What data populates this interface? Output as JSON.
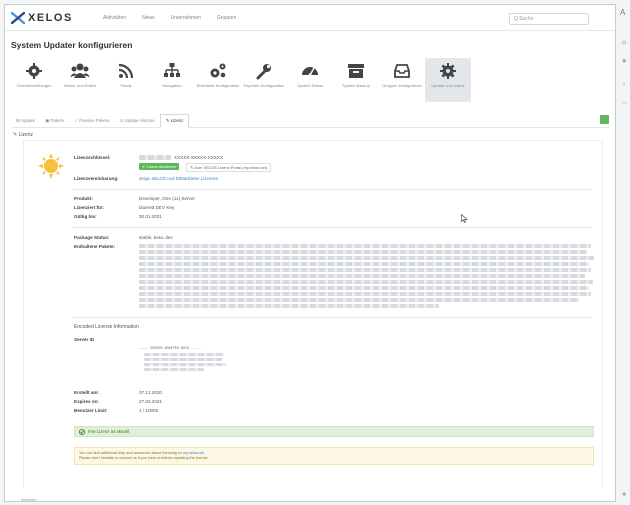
{
  "app": {
    "logo_text": "XELOS",
    "search_placeholder": "Q Suche"
  },
  "nav": [
    "Aktivitäten",
    "News",
    "Unternehmen",
    "Gruppen"
  ],
  "page_title": "System Updater konfigurieren",
  "iconbar": [
    {
      "label": "Grundeinstellungen",
      "icon": "gear-icon"
    },
    {
      "label": "Nutzer und Rollen",
      "icon": "users-icon"
    },
    {
      "label": "Feeds",
      "icon": "rss-icon"
    },
    {
      "label": "Navigation",
      "icon": "sitemap-icon"
    },
    {
      "label": "Erweiterte Konfiguration",
      "icon": "gears-icon"
    },
    {
      "label": "Experten Konfiguration",
      "icon": "wrench-icon"
    },
    {
      "label": "System Status",
      "icon": "dashboard-icon"
    },
    {
      "label": "System Backup",
      "icon": "archive-icon"
    },
    {
      "label": "Gruppen konfigurieren",
      "icon": "inbox-icon"
    },
    {
      "label": "Update und Lizenz",
      "icon": "cog-icon"
    }
  ],
  "tabs": [
    {
      "label": "⊞ Update",
      "active": false
    },
    {
      "label": "▣ Pakete",
      "active": false
    },
    {
      "label": "☆ Passive Pakete",
      "active": false
    },
    {
      "label": "⊙ Update Historie",
      "active": false
    },
    {
      "label": "✎ Lizenz",
      "active": true
    }
  ],
  "section_heading": "✎ Lizenz",
  "license": {
    "key_label": "Lizenzschlüssel:",
    "key_value": "XXXXX-XXXXX-XXXXX",
    "valid_badge": "✔ Lizenz aktivieren",
    "portal_link": "✎ Zum XELOS Lizenz Portal (my.xelos.net)",
    "agreement_label": "Lizenzvereinbarung:",
    "agreement_link": "Zeige XELOS und Drittanbieter Lizenzen",
    "product_label": "Produkt:",
    "product_value": "Developer, One (1x) Server",
    "licensee_label": "Lizenziert für:",
    "licensee_value": "bluered DEV Key",
    "valid_until_label": "Gültig bis:",
    "valid_until_value": "30.01.2021",
    "package_status_label": "Package Status:",
    "package_status_value": "stable, beta, dev",
    "packages_label": "Enthaltene Pakete:",
    "encoded_title": "Encoded License Information",
    "server_id_label": "Server ID",
    "code_header": "----- SERVER ADAPTER DATA -----",
    "created_label": "Erstellt am:",
    "created_value": "07.12.2020",
    "expires_label": "Expires on:",
    "expires_value": "27.02.2021",
    "user_limit_label": "Benutzer Limit:",
    "user_limit_value": "1 / 10000",
    "status_ok": "Ihre Lizenz ist aktuell",
    "help_text_1": "You can find additional help and resources about licensing on",
    "help_link": "my.xelos.net",
    "help_text_2": "Please don't hesitate to contact us if you have problems updating the license."
  },
  "footer_label": "Aktionen",
  "right_strip_label": "A"
}
